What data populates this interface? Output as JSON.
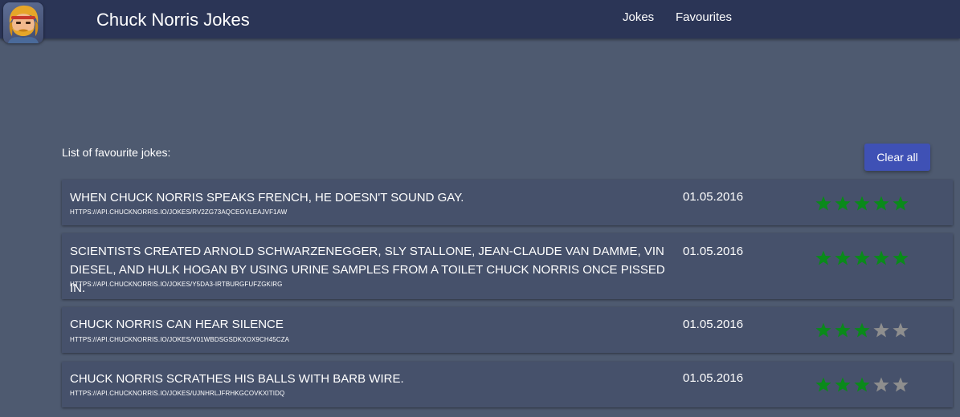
{
  "header": {
    "title": "Chuck Norris Jokes",
    "nav": [
      {
        "label": "Jokes"
      },
      {
        "label": "Favourites"
      }
    ]
  },
  "main": {
    "list_title": "List of favourite jokes:",
    "clear_label": "Clear all",
    "jokes": [
      {
        "text": "When Chuck Norris speaks french, he doesn't sound gay.",
        "url": "https://api.chucknorris.io/jokes/rv2zg73aqcegvleajvf1aw",
        "date": "01.05.2016",
        "rating": 5
      },
      {
        "text": "Scientists created Arnold Schwarzenegger, Sly Stallone, Jean-Claude Van Damme, Vin Diesel, and Hulk Hogan by using urine samples from a toilet Chuck Norris once pissed in.",
        "url": "https://api.chucknorris.io/jokes/y5da3-irtburgfufzgkirg",
        "date": "01.05.2016",
        "rating": 5
      },
      {
        "text": "Chuck Norris can hear silence",
        "url": "https://api.chucknorris.io/jokes/v01wbdsgsdkxox9ch45cza",
        "date": "01.05.2016",
        "rating": 3
      },
      {
        "text": "Chuck Norris scrathes his balls with barb wire.",
        "url": "https://api.chucknorris.io/jokes/ujnhrljfrhkgcovkxitidq",
        "date": "01.05.2016",
        "rating": 3
      }
    ],
    "star_max": 5
  },
  "colors": {
    "star_filled": "#0a8a1a",
    "star_empty": "#8e8e8e",
    "accent": "#3f51b5",
    "header_bg": "#2b3556"
  },
  "icons": {
    "logo": "bearded-man-avatar-icon",
    "star": "star-icon"
  }
}
